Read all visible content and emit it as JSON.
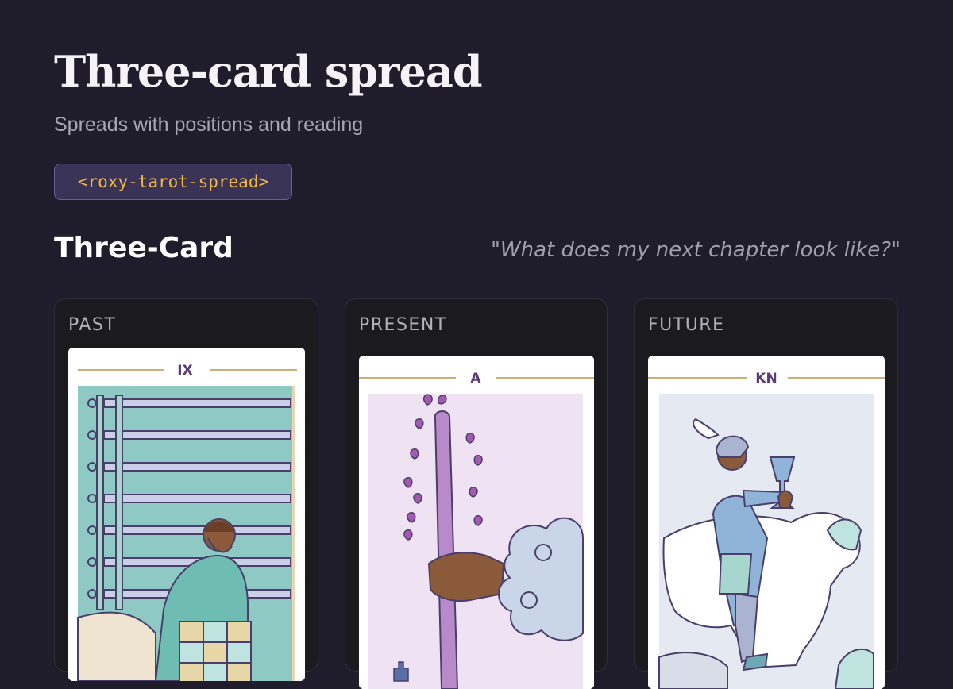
{
  "header": {
    "title": "Three-card spread",
    "subtitle": "Spreads with positions and reading",
    "tag": "<roxy-tarot-spread>"
  },
  "spread": {
    "name": "Three-Card",
    "question": "\"What does my next chapter look like?\"",
    "positions": [
      {
        "label": "PAST",
        "card_numeral": "IX",
        "card_icon": "nine-of-swords-illustration"
      },
      {
        "label": "PRESENT",
        "card_numeral": "A",
        "card_icon": "ace-of-wands-illustration"
      },
      {
        "label": "FUTURE",
        "card_numeral": "KN",
        "card_icon": "knight-of-cups-illustration"
      }
    ]
  },
  "colors": {
    "background": "#1f1d2b",
    "tag_text": "#f4b942",
    "tag_bg": "#3a3358",
    "card_accent": "#5b3b78"
  }
}
